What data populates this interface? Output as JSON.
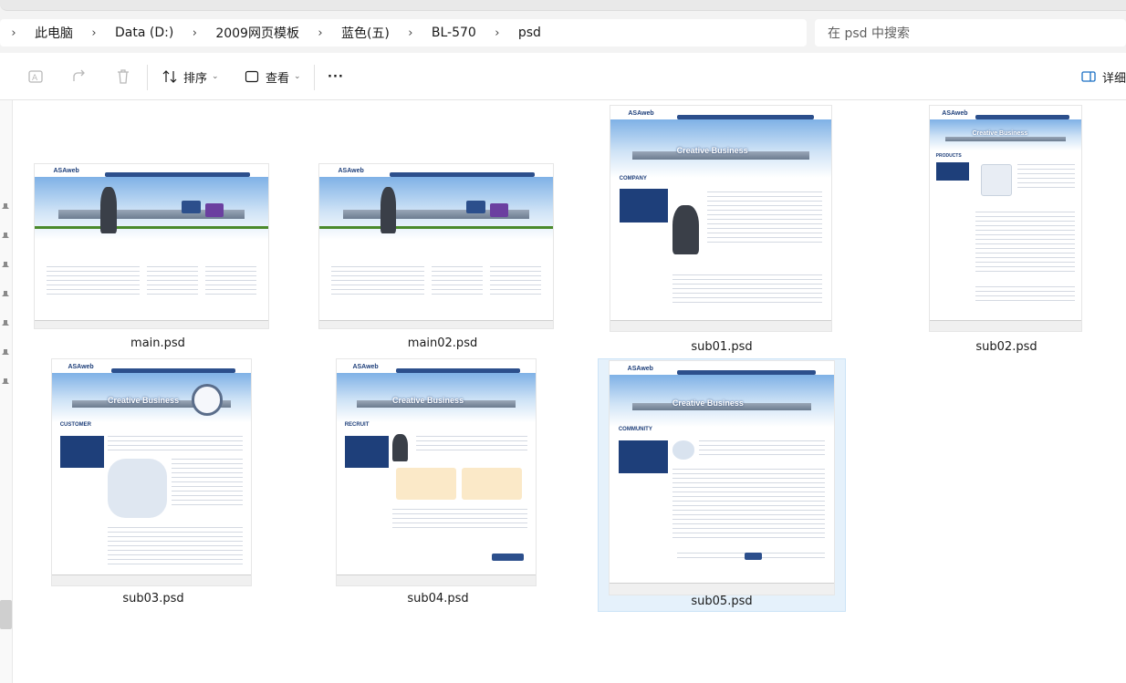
{
  "window": {
    "breadcrumb": [
      "此电脑",
      "Data (D:)",
      "2009网页模板",
      "蓝色(五)",
      "BL-570",
      "psd"
    ],
    "search_placeholder": "在 psd 中搜索"
  },
  "toolbar": {
    "sort_label": "排序",
    "view_label": "查看",
    "more_label": "···",
    "details_label": "详细"
  },
  "files": [
    {
      "name": "main.psd",
      "slogan": "",
      "selected": false
    },
    {
      "name": "main02.psd",
      "slogan": "",
      "selected": false
    },
    {
      "name": "sub01.psd",
      "slogan": "Creative Business",
      "section": "COMPANY",
      "selected": false
    },
    {
      "name": "sub02.psd",
      "slogan": "Creative Business",
      "section": "PRODUCTS",
      "selected": false
    },
    {
      "name": "sub03.psd",
      "slogan": "Creative Business",
      "section": "CUSTOMER",
      "selected": false
    },
    {
      "name": "sub04.psd",
      "slogan": "Creative Business",
      "section": "RECRUIT",
      "selected": false
    },
    {
      "name": "sub05.psd",
      "slogan": "Creative Business",
      "section": "COMMUNITY",
      "selected": true
    }
  ],
  "thumb_common": {
    "logo": "ASAweb"
  },
  "colors": {
    "accent": "#1e3f7a",
    "selection_bg": "#e5f1fb",
    "selection_border": "#cce4f7"
  }
}
